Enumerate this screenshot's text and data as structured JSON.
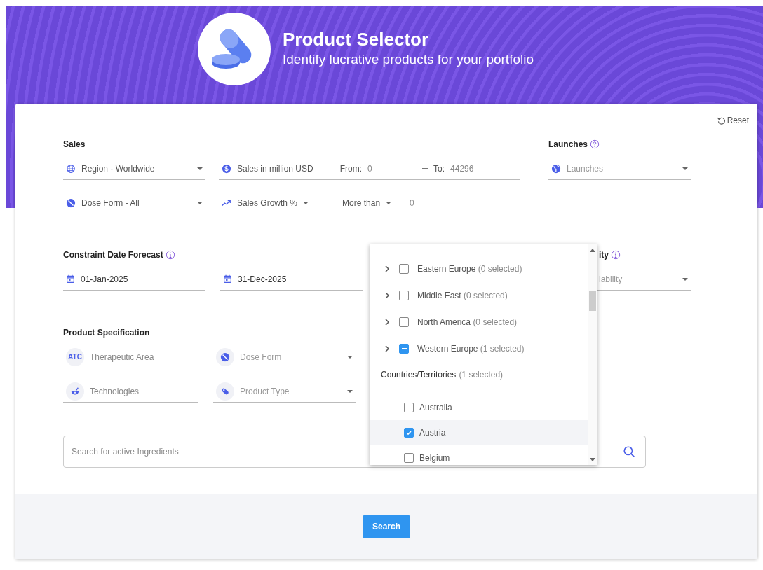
{
  "header": {
    "title": "Product Selector",
    "subtitle": "Identify lucrative products for your portfolio"
  },
  "reset_button": "Reset",
  "sales": {
    "label": "Sales",
    "region": {
      "value": "Region - Worldwide"
    },
    "sales_range": {
      "label": "Sales in million USD",
      "from_label": "From:",
      "from_placeholder": "0",
      "to_label": "To:",
      "to_placeholder": "44296"
    },
    "dose_form": {
      "value": "Dose Form - All"
    },
    "growth": {
      "label": "Sales Growth %",
      "operator": "More than",
      "placeholder": "0"
    }
  },
  "launches": {
    "label": "Launches",
    "placeholder": "Launches"
  },
  "forecast": {
    "label": "Constraint Date Forecast",
    "from": "01-Jan-2025",
    "to": "31-Dec-2025"
  },
  "availability": {
    "label": "ity",
    "placeholder": "lability"
  },
  "product_spec": {
    "label": "Product Specification",
    "fields": [
      {
        "kind": "text",
        "badge": "ATC",
        "placeholder": "Therapeutic Area"
      },
      {
        "kind": "select",
        "placeholder": "Dose Form"
      },
      {
        "kind": "text",
        "placeholder": "Technologies"
      },
      {
        "kind": "select",
        "placeholder": "Product Type"
      }
    ]
  },
  "search": {
    "placeholder": "Search for active Ingredients"
  },
  "search_button": "Search",
  "dropdown": {
    "regions": [
      {
        "name": "Eastern Europe",
        "count": "(0 selected)",
        "indeterminate": false,
        "expanded": false
      },
      {
        "name": "Middle East",
        "count": "(0 selected)",
        "indeterminate": false,
        "expanded": false
      },
      {
        "name": "North America",
        "count": "(0 selected)",
        "indeterminate": false,
        "expanded": false
      },
      {
        "name": "Western Europe",
        "count": "(1 selected)",
        "indeterminate": true,
        "expanded": false
      }
    ],
    "countries_header": {
      "label": "Countries/Territories",
      "count": "(1 selected)"
    },
    "countries": [
      {
        "name": "Australia",
        "checked": false,
        "highlighted": false
      },
      {
        "name": "Austria",
        "checked": true,
        "highlighted": true
      },
      {
        "name": "Belgium",
        "checked": false,
        "highlighted": false
      }
    ]
  }
}
